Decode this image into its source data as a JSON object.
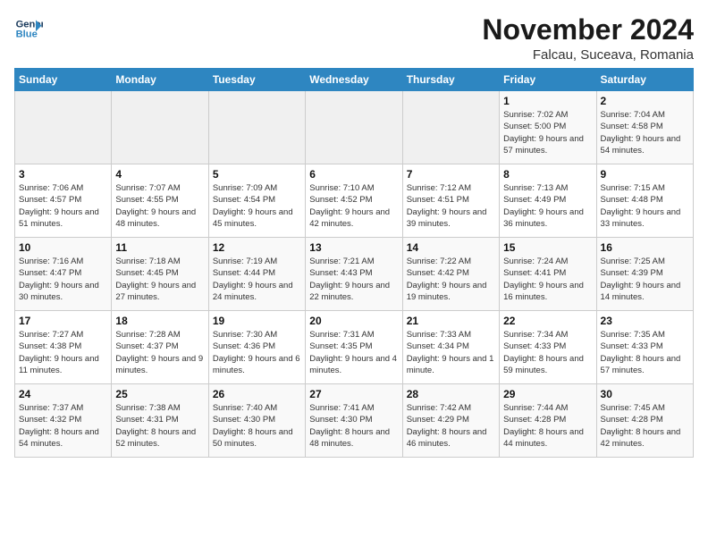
{
  "logo": {
    "line1": "General",
    "line2": "Blue"
  },
  "title": "November 2024",
  "location": "Falcau, Suceava, Romania",
  "weekdays": [
    "Sunday",
    "Monday",
    "Tuesday",
    "Wednesday",
    "Thursday",
    "Friday",
    "Saturday"
  ],
  "weeks": [
    [
      {
        "day": "",
        "info": ""
      },
      {
        "day": "",
        "info": ""
      },
      {
        "day": "",
        "info": ""
      },
      {
        "day": "",
        "info": ""
      },
      {
        "day": "",
        "info": ""
      },
      {
        "day": "1",
        "info": "Sunrise: 7:02 AM\nSunset: 5:00 PM\nDaylight: 9 hours and 57 minutes."
      },
      {
        "day": "2",
        "info": "Sunrise: 7:04 AM\nSunset: 4:58 PM\nDaylight: 9 hours and 54 minutes."
      }
    ],
    [
      {
        "day": "3",
        "info": "Sunrise: 7:06 AM\nSunset: 4:57 PM\nDaylight: 9 hours and 51 minutes."
      },
      {
        "day": "4",
        "info": "Sunrise: 7:07 AM\nSunset: 4:55 PM\nDaylight: 9 hours and 48 minutes."
      },
      {
        "day": "5",
        "info": "Sunrise: 7:09 AM\nSunset: 4:54 PM\nDaylight: 9 hours and 45 minutes."
      },
      {
        "day": "6",
        "info": "Sunrise: 7:10 AM\nSunset: 4:52 PM\nDaylight: 9 hours and 42 minutes."
      },
      {
        "day": "7",
        "info": "Sunrise: 7:12 AM\nSunset: 4:51 PM\nDaylight: 9 hours and 39 minutes."
      },
      {
        "day": "8",
        "info": "Sunrise: 7:13 AM\nSunset: 4:49 PM\nDaylight: 9 hours and 36 minutes."
      },
      {
        "day": "9",
        "info": "Sunrise: 7:15 AM\nSunset: 4:48 PM\nDaylight: 9 hours and 33 minutes."
      }
    ],
    [
      {
        "day": "10",
        "info": "Sunrise: 7:16 AM\nSunset: 4:47 PM\nDaylight: 9 hours and 30 minutes."
      },
      {
        "day": "11",
        "info": "Sunrise: 7:18 AM\nSunset: 4:45 PM\nDaylight: 9 hours and 27 minutes."
      },
      {
        "day": "12",
        "info": "Sunrise: 7:19 AM\nSunset: 4:44 PM\nDaylight: 9 hours and 24 minutes."
      },
      {
        "day": "13",
        "info": "Sunrise: 7:21 AM\nSunset: 4:43 PM\nDaylight: 9 hours and 22 minutes."
      },
      {
        "day": "14",
        "info": "Sunrise: 7:22 AM\nSunset: 4:42 PM\nDaylight: 9 hours and 19 minutes."
      },
      {
        "day": "15",
        "info": "Sunrise: 7:24 AM\nSunset: 4:41 PM\nDaylight: 9 hours and 16 minutes."
      },
      {
        "day": "16",
        "info": "Sunrise: 7:25 AM\nSunset: 4:39 PM\nDaylight: 9 hours and 14 minutes."
      }
    ],
    [
      {
        "day": "17",
        "info": "Sunrise: 7:27 AM\nSunset: 4:38 PM\nDaylight: 9 hours and 11 minutes."
      },
      {
        "day": "18",
        "info": "Sunrise: 7:28 AM\nSunset: 4:37 PM\nDaylight: 9 hours and 9 minutes."
      },
      {
        "day": "19",
        "info": "Sunrise: 7:30 AM\nSunset: 4:36 PM\nDaylight: 9 hours and 6 minutes."
      },
      {
        "day": "20",
        "info": "Sunrise: 7:31 AM\nSunset: 4:35 PM\nDaylight: 9 hours and 4 minutes."
      },
      {
        "day": "21",
        "info": "Sunrise: 7:33 AM\nSunset: 4:34 PM\nDaylight: 9 hours and 1 minute."
      },
      {
        "day": "22",
        "info": "Sunrise: 7:34 AM\nSunset: 4:33 PM\nDaylight: 8 hours and 59 minutes."
      },
      {
        "day": "23",
        "info": "Sunrise: 7:35 AM\nSunset: 4:33 PM\nDaylight: 8 hours and 57 minutes."
      }
    ],
    [
      {
        "day": "24",
        "info": "Sunrise: 7:37 AM\nSunset: 4:32 PM\nDaylight: 8 hours and 54 minutes."
      },
      {
        "day": "25",
        "info": "Sunrise: 7:38 AM\nSunset: 4:31 PM\nDaylight: 8 hours and 52 minutes."
      },
      {
        "day": "26",
        "info": "Sunrise: 7:40 AM\nSunset: 4:30 PM\nDaylight: 8 hours and 50 minutes."
      },
      {
        "day": "27",
        "info": "Sunrise: 7:41 AM\nSunset: 4:30 PM\nDaylight: 8 hours and 48 minutes."
      },
      {
        "day": "28",
        "info": "Sunrise: 7:42 AM\nSunset: 4:29 PM\nDaylight: 8 hours and 46 minutes."
      },
      {
        "day": "29",
        "info": "Sunrise: 7:44 AM\nSunset: 4:28 PM\nDaylight: 8 hours and 44 minutes."
      },
      {
        "day": "30",
        "info": "Sunrise: 7:45 AM\nSunset: 4:28 PM\nDaylight: 8 hours and 42 minutes."
      }
    ]
  ]
}
